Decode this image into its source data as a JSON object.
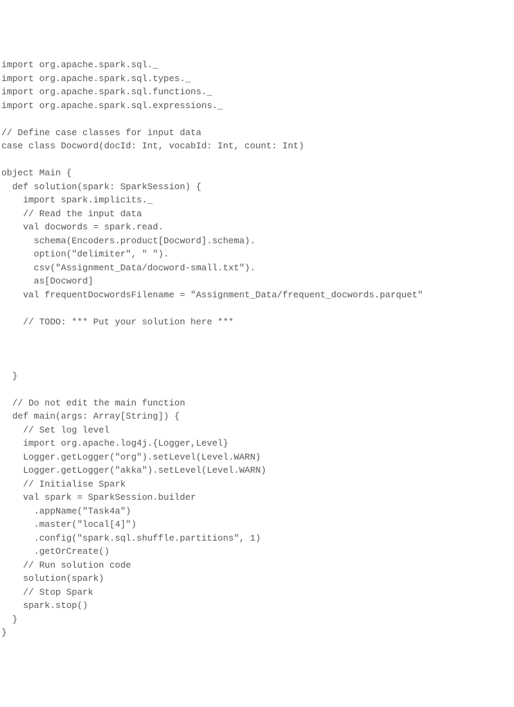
{
  "code": {
    "lines": [
      "import org.apache.spark.sql._",
      "import org.apache.spark.sql.types._",
      "import org.apache.spark.sql.functions._",
      "import org.apache.spark.sql.expressions._",
      "",
      "// Define case classes for input data",
      "case class Docword(docId: Int, vocabId: Int, count: Int)",
      "",
      "object Main {",
      "  def solution(spark: SparkSession) {",
      "    import spark.implicits._",
      "    // Read the input data",
      "    val docwords = spark.read.",
      "      schema(Encoders.product[Docword].schema).",
      "      option(\"delimiter\", \" \").",
      "      csv(\"Assignment_Data/docword-small.txt\").",
      "      as[Docword]",
      "    val frequentDocwordsFilename = \"Assignment_Data/frequent_docwords.parquet\"",
      "",
      "    // TODO: *** Put your solution here ***",
      "",
      "",
      "",
      "  }",
      "",
      "  // Do not edit the main function",
      "  def main(args: Array[String]) {",
      "    // Set log level",
      "    import org.apache.log4j.{Logger,Level}",
      "    Logger.getLogger(\"org\").setLevel(Level.WARN)",
      "    Logger.getLogger(\"akka\").setLevel(Level.WARN)",
      "    // Initialise Spark",
      "    val spark = SparkSession.builder",
      "      .appName(\"Task4a\")",
      "      .master(\"local[4]\")",
      "      .config(\"spark.sql.shuffle.partitions\", 1)",
      "      .getOrCreate()",
      "    // Run solution code",
      "    solution(spark)",
      "    // Stop Spark",
      "    spark.stop()",
      "  }",
      "}"
    ]
  }
}
